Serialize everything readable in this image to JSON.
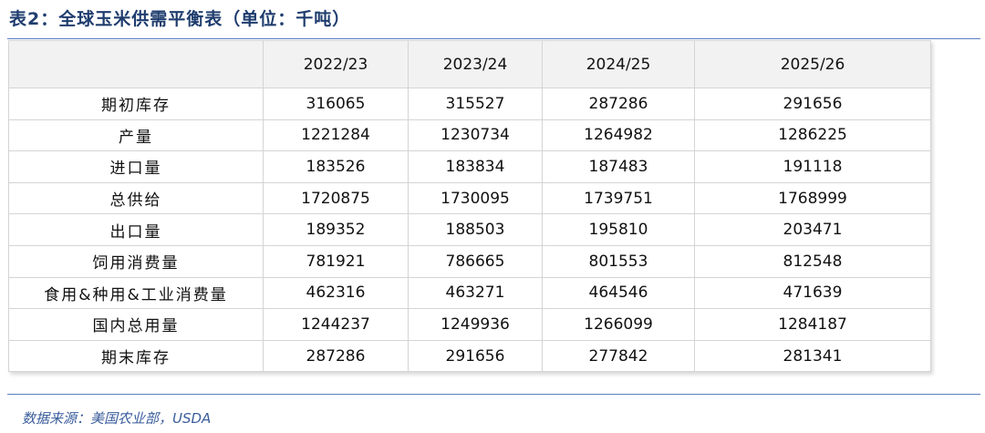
{
  "title": "表2：全球玉米供需平衡表（单位：千吨）",
  "columns": [
    "",
    "2022/23",
    "2023/24",
    "2024/25",
    "2025/26"
  ],
  "rows": [
    [
      "期初库存",
      "316065",
      "315527",
      "287286",
      "291656"
    ],
    [
      "产量",
      "1221284",
      "1230734",
      "1264982",
      "1286225"
    ],
    [
      "进口量",
      "183526",
      "183834",
      "187483",
      "191118"
    ],
    [
      "总供给",
      "1720875",
      "1730095",
      "1739751",
      "1768999"
    ],
    [
      "出口量",
      "189352",
      "188503",
      "195810",
      "203471"
    ],
    [
      "饲用消费量",
      "781921",
      "786665",
      "801553",
      "812548"
    ],
    [
      "食用&种用&工业消费量",
      "462316",
      "463271",
      "464546",
      "471639"
    ],
    [
      "国内总用量",
      "1244237",
      "1249936",
      "1266099",
      "1284187"
    ],
    [
      "期末库存",
      "287286",
      "291656",
      "277842",
      "281341"
    ]
  ],
  "source": "数据来源：美国农业部，USDA"
}
